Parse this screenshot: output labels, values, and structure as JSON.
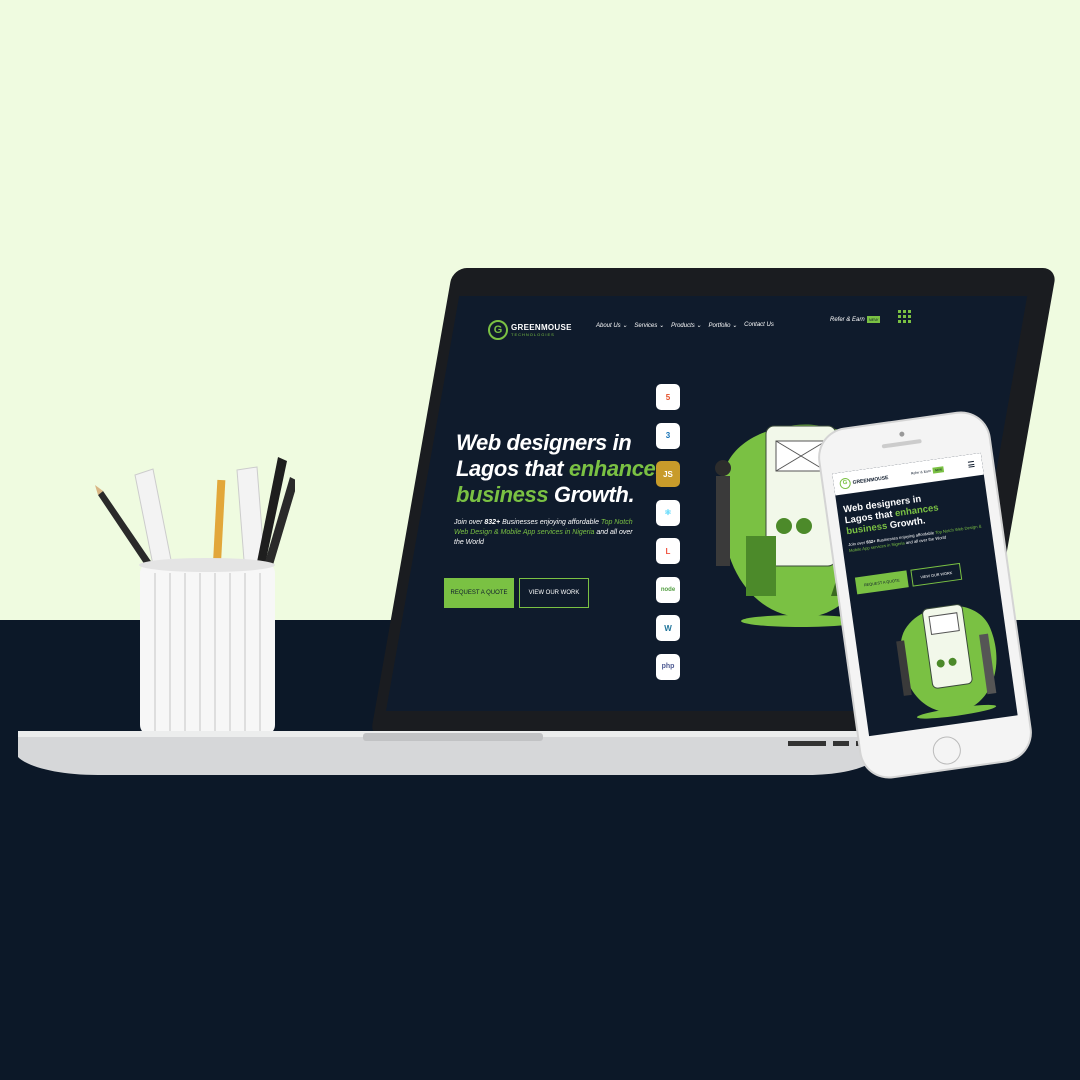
{
  "brand": {
    "name": "GREENMOUSE",
    "tagline": "TECHNOLOGIES",
    "accent": "#7ac143",
    "dark": "#0f1b2c",
    "top_bg": "#effbe0",
    "bottom_bg": "#0c1828"
  },
  "nav": {
    "items": [
      "About Us ⌄",
      "Services ⌄",
      "Products ⌄",
      "Portfolio ⌄",
      "Contact Us"
    ],
    "refer_label": "Refer & Earn",
    "new_badge": "NEW",
    "grid_icon": "apps-grid-icon"
  },
  "hero": {
    "title_line1": "Web designers in",
    "title_line2_a": "Lagos that ",
    "title_line2_b": "enhances",
    "title_line3_a": "business",
    "title_line3_b": " Growth.",
    "desc_a": "Join over ",
    "desc_count": "832+",
    "desc_b": " Businesses enjoying affordable ",
    "desc_highlight": "Top Notch Web Design & Mobile App services in Nigeria",
    "desc_c": " and all over the World",
    "primary_button": "REQUEST A QUOTE",
    "secondary_button": "VIEW OUR WORK"
  },
  "tech_icons": [
    {
      "name": "html5-icon",
      "label": "5",
      "color": "#e44d26"
    },
    {
      "name": "css3-icon",
      "label": "3",
      "color": "#1572b6"
    },
    {
      "name": "javascript-icon",
      "label": "JS",
      "color": "#c89b2a"
    },
    {
      "name": "react-icon",
      "label": "⚛",
      "color": "#61dafb"
    },
    {
      "name": "laravel-icon",
      "label": "L",
      "color": "#f05340"
    },
    {
      "name": "nodejs-icon",
      "label": "node",
      "color": "#539e43"
    },
    {
      "name": "wordpress-icon",
      "label": "W",
      "color": "#21759b"
    },
    {
      "name": "php-icon",
      "label": "php",
      "color": "#4f5b93"
    }
  ],
  "phone": {
    "refer_label": "Refer & Earn"
  }
}
